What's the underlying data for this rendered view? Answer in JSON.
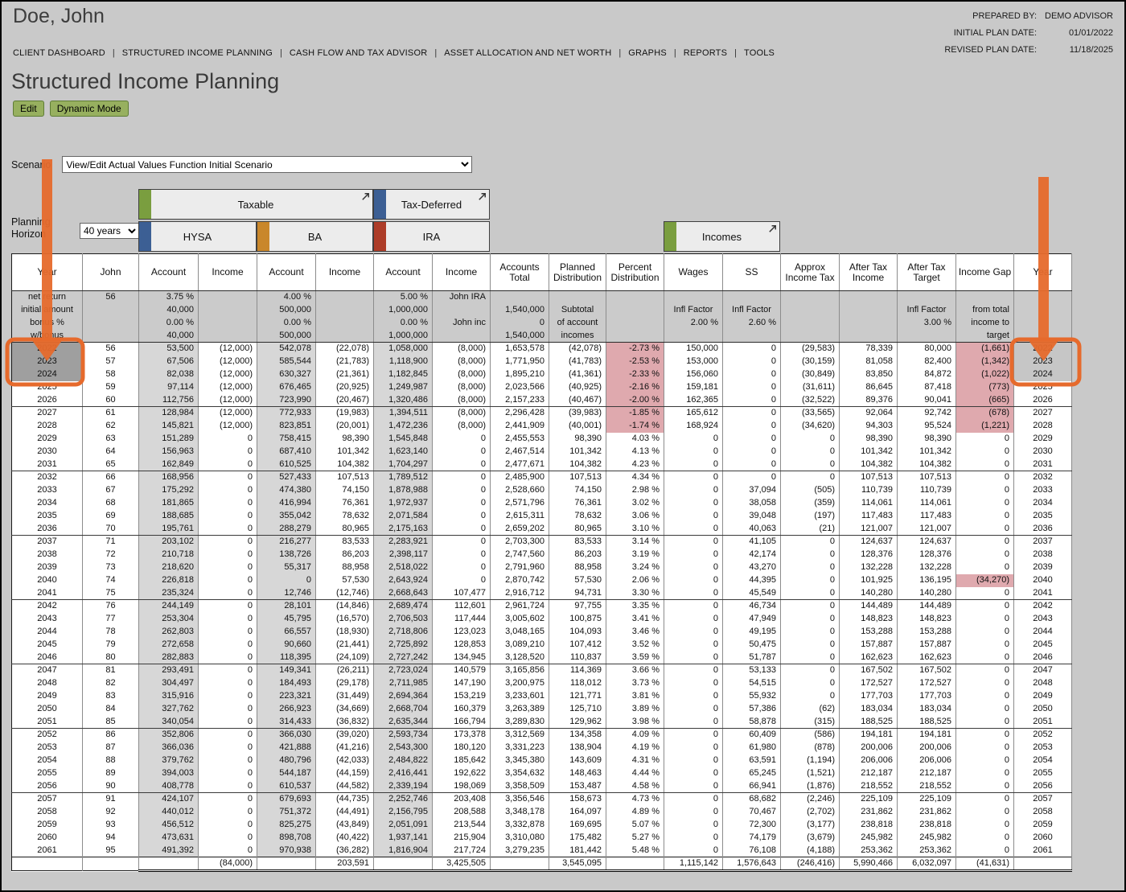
{
  "header": {
    "client_name": "Doe, John",
    "prepared_by_label": "PREPARED BY:",
    "prepared_by_value": "DEMO ADVISOR",
    "initial_plan_label": "INITIAL PLAN DATE:",
    "initial_plan_value": "01/01/2022",
    "revised_plan_label": "REVISED PLAN DATE:",
    "revised_plan_value": "11/18/2025"
  },
  "nav": {
    "items": [
      "CLIENT DASHBOARD",
      "STRUCTURED INCOME PLANNING",
      "CASH FLOW AND TAX ADVISOR",
      "ASSET ALLOCATION AND NET WORTH",
      "GRAPHS",
      "REPORTS",
      "TOOLS"
    ]
  },
  "page": {
    "title": "Structured Income Planning",
    "edit_button": "Edit",
    "dynamic_mode_button": "Dynamic Mode"
  },
  "scenario": {
    "label": "Scenario",
    "selected": "View/Edit Actual Values Function Initial Scenario"
  },
  "planning_horizon": {
    "label": "Planning Horizon",
    "selected": "40 years"
  },
  "groups": {
    "taxable": "Taxable",
    "tax_deferred": "Tax-Deferred",
    "hysa": "HYSA",
    "ba": "BA",
    "ira": "IRA",
    "incomes": "Incomes"
  },
  "table": {
    "columns": [
      "Year",
      "John",
      "Account",
      "Income",
      "Account",
      "Income",
      "Account",
      "Income",
      "Accounts Total",
      "Planned Distribution",
      "Percent Distribution",
      "Wages",
      "SS",
      "Approx Income Tax",
      "After Tax Income",
      "After Tax Target",
      "Income Gap",
      "Year"
    ],
    "meta_rows": [
      [
        "net return",
        "56",
        "3.75 %",
        "",
        "4.00 %",
        "",
        "5.00 %",
        "John IRA",
        "",
        "",
        "",
        "",
        "",
        "",
        "",
        "",
        "",
        ""
      ],
      [
        "initial amount",
        "",
        "40,000",
        "",
        "500,000",
        "",
        "1,000,000",
        "",
        "1,540,000",
        "Subtotal",
        "",
        "Infl Factor",
        "Infl Factor",
        "",
        "",
        "Infl Factor",
        "from total",
        ""
      ],
      [
        "bonus %",
        "",
        "0.00 %",
        "",
        "0.00 %",
        "",
        "0.00 %",
        "John inc",
        "0",
        "of account",
        "",
        "2.00 %",
        "2.60 %",
        "",
        "",
        "3.00 %",
        "income to",
        ""
      ],
      [
        "w/bonus",
        "",
        "40,000",
        "",
        "500,000",
        "",
        "1,000,000",
        "",
        "1,540,000",
        "incomes",
        "",
        "",
        "",
        "",
        "",
        "",
        "target",
        ""
      ]
    ],
    "rows": [
      [
        "2022",
        "56",
        "53,500",
        "(12,000)",
        "542,078",
        "(22,078)",
        "1,058,000",
        "(8,000)",
        "1,653,578",
        "(42,078)",
        "-2.73 %",
        "150,000",
        "0",
        "(29,583)",
        "78,339",
        "80,000",
        "(1,661)",
        "2022"
      ],
      [
        "2023",
        "57",
        "67,506",
        "(12,000)",
        "585,544",
        "(21,783)",
        "1,118,900",
        "(8,000)",
        "1,771,950",
        "(41,783)",
        "-2.53 %",
        "153,000",
        "0",
        "(30,159)",
        "81,058",
        "82,400",
        "(1,342)",
        "2023"
      ],
      [
        "2024",
        "58",
        "82,038",
        "(12,000)",
        "630,327",
        "(21,361)",
        "1,182,845",
        "(8,000)",
        "1,895,210",
        "(41,361)",
        "-2.33 %",
        "156,060",
        "0",
        "(30,849)",
        "83,850",
        "84,872",
        "(1,022)",
        "2024"
      ],
      [
        "2025",
        "59",
        "97,114",
        "(12,000)",
        "676,465",
        "(20,925)",
        "1,249,987",
        "(8,000)",
        "2,023,566",
        "(40,925)",
        "-2.16 %",
        "159,181",
        "0",
        "(31,611)",
        "86,645",
        "87,418",
        "(773)",
        "2025"
      ],
      [
        "2026",
        "60",
        "112,756",
        "(12,000)",
        "723,990",
        "(20,467)",
        "1,320,486",
        "(8,000)",
        "2,157,233",
        "(40,467)",
        "-2.00 %",
        "162,365",
        "0",
        "(32,522)",
        "89,376",
        "90,041",
        "(665)",
        "2026"
      ],
      [
        "2027",
        "61",
        "128,984",
        "(12,000)",
        "772,933",
        "(19,983)",
        "1,394,511",
        "(8,000)",
        "2,296,428",
        "(39,983)",
        "-1.85 %",
        "165,612",
        "0",
        "(33,565)",
        "92,064",
        "92,742",
        "(678)",
        "2027"
      ],
      [
        "2028",
        "62",
        "145,821",
        "(12,000)",
        "823,851",
        "(20,001)",
        "1,472,236",
        "(8,000)",
        "2,441,909",
        "(40,001)",
        "-1.74 %",
        "168,924",
        "0",
        "(34,620)",
        "94,303",
        "95,524",
        "(1,221)",
        "2028"
      ],
      [
        "2029",
        "63",
        "151,289",
        "0",
        "758,415",
        "98,390",
        "1,545,848",
        "0",
        "2,455,553",
        "98,390",
        "4.03 %",
        "0",
        "0",
        "0",
        "98,390",
        "98,390",
        "0",
        "2029"
      ],
      [
        "2030",
        "64",
        "156,963",
        "0",
        "687,410",
        "101,342",
        "1,623,140",
        "0",
        "2,467,514",
        "101,342",
        "4.13 %",
        "0",
        "0",
        "0",
        "101,342",
        "101,342",
        "0",
        "2030"
      ],
      [
        "2031",
        "65",
        "162,849",
        "0",
        "610,525",
        "104,382",
        "1,704,297",
        "0",
        "2,477,671",
        "104,382",
        "4.23 %",
        "0",
        "0",
        "0",
        "104,382",
        "104,382",
        "0",
        "2031"
      ],
      [
        "2032",
        "66",
        "168,956",
        "0",
        "527,433",
        "107,513",
        "1,789,512",
        "0",
        "2,485,900",
        "107,513",
        "4.34 %",
        "0",
        "0",
        "0",
        "107,513",
        "107,513",
        "0",
        "2032"
      ],
      [
        "2033",
        "67",
        "175,292",
        "0",
        "474,380",
        "74,150",
        "1,878,988",
        "0",
        "2,528,660",
        "74,150",
        "2.98 %",
        "0",
        "37,094",
        "(505)",
        "110,739",
        "110,739",
        "0",
        "2033"
      ],
      [
        "2034",
        "68",
        "181,865",
        "0",
        "416,994",
        "76,361",
        "1,972,937",
        "0",
        "2,571,796",
        "76,361",
        "3.02 %",
        "0",
        "38,058",
        "(359)",
        "114,061",
        "114,061",
        "0",
        "2034"
      ],
      [
        "2035",
        "69",
        "188,685",
        "0",
        "355,042",
        "78,632",
        "2,071,584",
        "0",
        "2,615,311",
        "78,632",
        "3.06 %",
        "0",
        "39,048",
        "(197)",
        "117,483",
        "117,483",
        "0",
        "2035"
      ],
      [
        "2036",
        "70",
        "195,761",
        "0",
        "288,279",
        "80,965",
        "2,175,163",
        "0",
        "2,659,202",
        "80,965",
        "3.10 %",
        "0",
        "40,063",
        "(21)",
        "121,007",
        "121,007",
        "0",
        "2036"
      ],
      [
        "2037",
        "71",
        "203,102",
        "0",
        "216,277",
        "83,533",
        "2,283,921",
        "0",
        "2,703,300",
        "83,533",
        "3.14 %",
        "0",
        "41,105",
        "0",
        "124,637",
        "124,637",
        "0",
        "2037"
      ],
      [
        "2038",
        "72",
        "210,718",
        "0",
        "138,726",
        "86,203",
        "2,398,117",
        "0",
        "2,747,560",
        "86,203",
        "3.19 %",
        "0",
        "42,174",
        "0",
        "128,376",
        "128,376",
        "0",
        "2038"
      ],
      [
        "2039",
        "73",
        "218,620",
        "0",
        "55,317",
        "88,958",
        "2,518,022",
        "0",
        "2,791,960",
        "88,958",
        "3.24 %",
        "0",
        "43,270",
        "0",
        "132,228",
        "132,228",
        "0",
        "2039"
      ],
      [
        "2040",
        "74",
        "226,818",
        "0",
        "0",
        "57,530",
        "2,643,924",
        "0",
        "2,870,742",
        "57,530",
        "2.06 %",
        "0",
        "44,395",
        "0",
        "101,925",
        "136,195",
        "(34,270)",
        "2040"
      ],
      [
        "2041",
        "75",
        "235,324",
        "0",
        "12,746",
        "(12,746)",
        "2,668,643",
        "107,477",
        "2,916,712",
        "94,731",
        "3.30 %",
        "0",
        "45,549",
        "0",
        "140,280",
        "140,280",
        "0",
        "2041"
      ],
      [
        "2042",
        "76",
        "244,149",
        "0",
        "28,101",
        "(14,846)",
        "2,689,474",
        "112,601",
        "2,961,724",
        "97,755",
        "3.35 %",
        "0",
        "46,734",
        "0",
        "144,489",
        "144,489",
        "0",
        "2042"
      ],
      [
        "2043",
        "77",
        "253,304",
        "0",
        "45,795",
        "(16,570)",
        "2,706,503",
        "117,444",
        "3,005,602",
        "100,875",
        "3.41 %",
        "0",
        "47,949",
        "0",
        "148,823",
        "148,823",
        "0",
        "2043"
      ],
      [
        "2044",
        "78",
        "262,803",
        "0",
        "66,557",
        "(18,930)",
        "2,718,806",
        "123,023",
        "3,048,165",
        "104,093",
        "3.46 %",
        "0",
        "49,195",
        "0",
        "153,288",
        "153,288",
        "0",
        "2044"
      ],
      [
        "2045",
        "79",
        "272,658",
        "0",
        "90,660",
        "(21,441)",
        "2,725,892",
        "128,853",
        "3,089,210",
        "107,412",
        "3.52 %",
        "0",
        "50,475",
        "0",
        "157,887",
        "157,887",
        "0",
        "2045"
      ],
      [
        "2046",
        "80",
        "282,883",
        "0",
        "118,395",
        "(24,109)",
        "2,727,242",
        "134,945",
        "3,128,520",
        "110,837",
        "3.59 %",
        "0",
        "51,787",
        "0",
        "162,623",
        "162,623",
        "0",
        "2046"
      ],
      [
        "2047",
        "81",
        "293,491",
        "0",
        "149,341",
        "(26,211)",
        "2,723,024",
        "140,579",
        "3,165,856",
        "114,369",
        "3.66 %",
        "0",
        "53,133",
        "0",
        "167,502",
        "167,502",
        "0",
        "2047"
      ],
      [
        "2048",
        "82",
        "304,497",
        "0",
        "184,493",
        "(29,178)",
        "2,711,985",
        "147,190",
        "3,200,975",
        "118,012",
        "3.73 %",
        "0",
        "54,515",
        "0",
        "172,527",
        "172,527",
        "0",
        "2048"
      ],
      [
        "2049",
        "83",
        "315,916",
        "0",
        "223,321",
        "(31,449)",
        "2,694,364",
        "153,219",
        "3,233,601",
        "121,771",
        "3.81 %",
        "0",
        "55,932",
        "0",
        "177,703",
        "177,703",
        "0",
        "2049"
      ],
      [
        "2050",
        "84",
        "327,762",
        "0",
        "266,923",
        "(34,669)",
        "2,668,704",
        "160,379",
        "3,263,389",
        "125,710",
        "3.89 %",
        "0",
        "57,386",
        "(62)",
        "183,034",
        "183,034",
        "0",
        "2050"
      ],
      [
        "2051",
        "85",
        "340,054",
        "0",
        "314,433",
        "(36,832)",
        "2,635,344",
        "166,794",
        "3,289,830",
        "129,962",
        "3.98 %",
        "0",
        "58,878",
        "(315)",
        "188,525",
        "188,525",
        "0",
        "2051"
      ],
      [
        "2052",
        "86",
        "352,806",
        "0",
        "366,030",
        "(39,020)",
        "2,593,734",
        "173,378",
        "3,312,569",
        "134,358",
        "4.09 %",
        "0",
        "60,409",
        "(586)",
        "194,181",
        "194,181",
        "0",
        "2052"
      ],
      [
        "2053",
        "87",
        "366,036",
        "0",
        "421,888",
        "(41,216)",
        "2,543,300",
        "180,120",
        "3,331,223",
        "138,904",
        "4.19 %",
        "0",
        "61,980",
        "(878)",
        "200,006",
        "200,006",
        "0",
        "2053"
      ],
      [
        "2054",
        "88",
        "379,762",
        "0",
        "480,796",
        "(42,033)",
        "2,484,822",
        "185,642",
        "3,345,380",
        "143,609",
        "4.31 %",
        "0",
        "63,591",
        "(1,194)",
        "206,006",
        "206,006",
        "0",
        "2054"
      ],
      [
        "2055",
        "89",
        "394,003",
        "0",
        "544,187",
        "(44,159)",
        "2,416,441",
        "192,622",
        "3,354,632",
        "148,463",
        "4.44 %",
        "0",
        "65,245",
        "(1,521)",
        "212,187",
        "212,187",
        "0",
        "2055"
      ],
      [
        "2056",
        "90",
        "408,778",
        "0",
        "610,537",
        "(44,582)",
        "2,339,194",
        "198,069",
        "3,358,509",
        "153,487",
        "4.58 %",
        "0",
        "66,941",
        "(1,876)",
        "218,552",
        "218,552",
        "0",
        "2056"
      ],
      [
        "2057",
        "91",
        "424,107",
        "0",
        "679,693",
        "(44,735)",
        "2,252,746",
        "203,408",
        "3,356,546",
        "158,673",
        "4.73 %",
        "0",
        "68,682",
        "(2,246)",
        "225,109",
        "225,109",
        "0",
        "2057"
      ],
      [
        "2058",
        "92",
        "440,012",
        "0",
        "751,372",
        "(44,491)",
        "2,156,795",
        "208,588",
        "3,348,178",
        "164,097",
        "4.89 %",
        "0",
        "70,467",
        "(2,702)",
        "231,862",
        "231,862",
        "0",
        "2058"
      ],
      [
        "2059",
        "93",
        "456,512",
        "0",
        "825,275",
        "(43,849)",
        "2,051,091",
        "213,544",
        "3,332,878",
        "169,695",
        "5.07 %",
        "0",
        "72,300",
        "(3,177)",
        "238,818",
        "238,818",
        "0",
        "2059"
      ],
      [
        "2060",
        "94",
        "473,631",
        "0",
        "898,708",
        "(40,422)",
        "1,937,141",
        "215,904",
        "3,310,080",
        "175,482",
        "5.27 %",
        "0",
        "74,179",
        "(3,679)",
        "245,982",
        "245,982",
        "0",
        "2060"
      ],
      [
        "2061",
        "95",
        "491,392",
        "0",
        "970,938",
        "(36,282)",
        "1,816,904",
        "217,724",
        "3,279,235",
        "181,442",
        "5.48 %",
        "0",
        "76,108",
        "(4,188)",
        "253,362",
        "253,362",
        "0",
        "2061"
      ]
    ],
    "totals": [
      "",
      "",
      "",
      "(84,000)",
      "",
      "203,591",
      "",
      "3,425,505",
      "",
      "3,545,095",
      "",
      "1,115,142",
      "1,576,643",
      "(246,416)",
      "5,990,466",
      "6,032,097",
      "(41,631)",
      ""
    ],
    "selected_years": [
      "2022",
      "2023",
      "2024"
    ],
    "group_end_years": [
      "2026",
      "2031",
      "2036",
      "2041",
      "2046",
      "2051",
      "2056"
    ]
  },
  "colors": {
    "annotation_orange": "#e66a2c",
    "tan_cell": "#d09a5b",
    "pink_cell": "#dfa9ae",
    "selected_year_left": "#9f9f9f",
    "selected_year_right": "#c6c6c6",
    "button_green": "#97b05f",
    "tab_taxable": "#7a9e3f",
    "tab_tax_deferred": "#3c5f94",
    "tab_hysa": "#3c5f94",
    "tab_ba": "#c9872b",
    "tab_ira": "#ad3c28",
    "tab_incomes": "#7a9e3f"
  }
}
